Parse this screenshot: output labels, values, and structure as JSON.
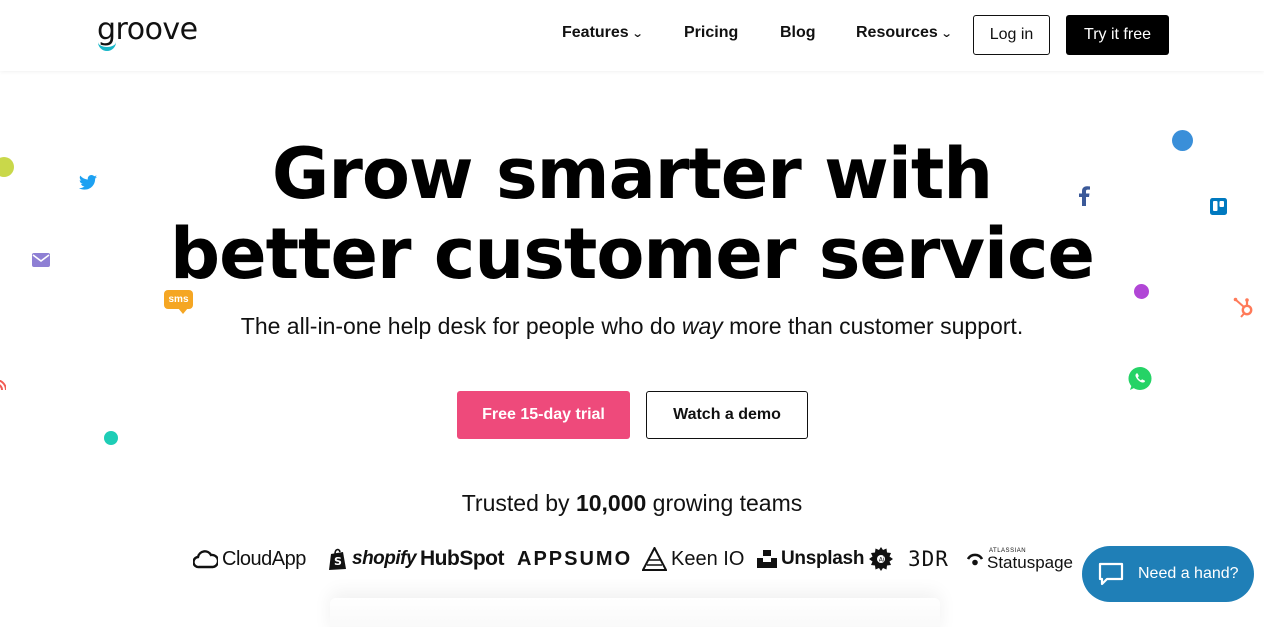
{
  "header": {
    "logo_text": "groove",
    "nav": {
      "features": "Features",
      "pricing": "Pricing",
      "blog": "Blog",
      "resources": "Resources",
      "login": "Log in",
      "try_free": "Try it free"
    }
  },
  "hero": {
    "title_line1": "Grow smarter with",
    "title_line2": "better customer service",
    "subtitle_before": "The all-in-one help desk for people who do ",
    "subtitle_em": "way",
    "subtitle_after": " more than customer support.",
    "cta_primary": "Free 15-day trial",
    "cta_secondary": "Watch a demo"
  },
  "trusted": {
    "before": "Trusted by ",
    "count": "10,000",
    "after": " growing teams"
  },
  "brands": [
    "CloudApp",
    "shopify",
    "HubSpot",
    "APPSUMO",
    "Keen IO",
    "Unsplash",
    "3DR",
    "Statuspage"
  ],
  "brand_extra": {
    "statuspage_top": "ATLASSIAN",
    "sms_badge": "sms"
  },
  "chat": {
    "label": "Need a hand?"
  },
  "colors": {
    "primary_pink": "#ee4a7b",
    "chat_blue": "#1f7fb7",
    "logo_teal": "#18b6c8"
  },
  "icons": [
    "twitter-icon",
    "mail-icon",
    "sms-icon",
    "facebook-icon",
    "trello-icon",
    "hubspot-icon",
    "whatsapp-icon",
    "rss-icon",
    "chat-bubble-icon",
    "chevron-down-icon"
  ]
}
